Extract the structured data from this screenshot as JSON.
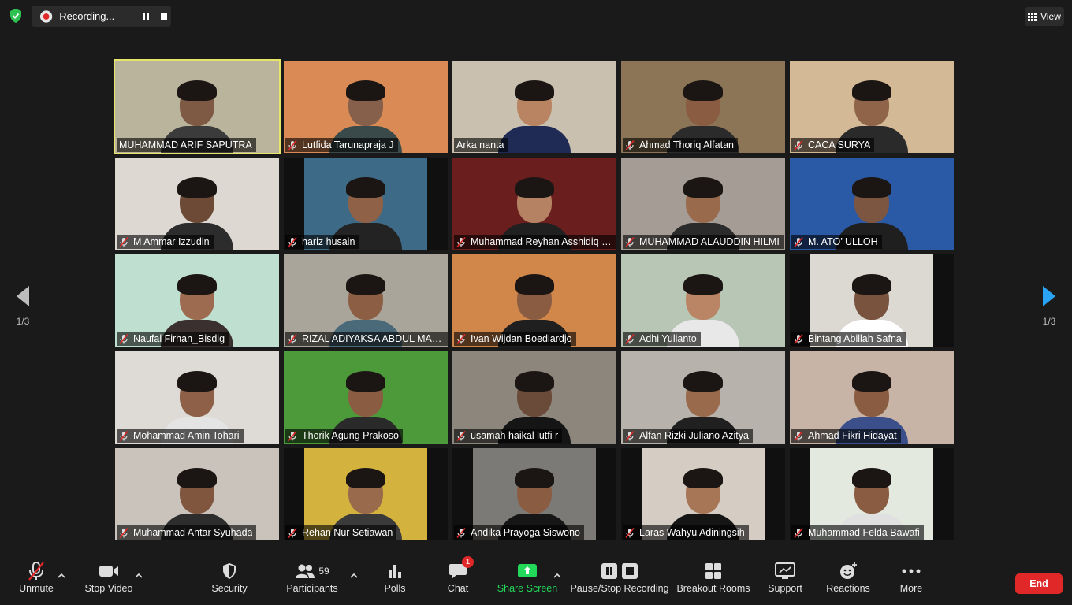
{
  "topbar": {
    "recording_label": "Recording...",
    "view_label": "View"
  },
  "nav": {
    "left_page": "1/3",
    "right_page": "1/3"
  },
  "participants": [
    {
      "name": "MUHAMMAD ARIF SAPUTRA",
      "muted": false,
      "active": true,
      "bg": "#b9b49b",
      "skin": "#7e5a45",
      "shirt": "#3b3b3b"
    },
    {
      "name": "Lutfida Tarunapraja J",
      "muted": true,
      "bg": "#d98a55",
      "skin": "#86604a",
      "shirt": "#3a4a4a"
    },
    {
      "name": "Arka nanta",
      "muted": false,
      "bg": "#c9c0b0",
      "skin": "#b88462",
      "shirt": "#1f2a55"
    },
    {
      "name": "Ahmad Thoriq Alfatan",
      "muted": true,
      "bg": "#8c7456",
      "skin": "#8a5d43",
      "shirt": "#2b2b2b"
    },
    {
      "name": "CACA SURYA",
      "muted": true,
      "bg": "#d4b996",
      "skin": "#8f6448",
      "shirt": "#2a2a2a"
    },
    {
      "name": "M Ammar Izzudin",
      "muted": true,
      "bg": "#ddd8d2",
      "skin": "#6d4a36",
      "shirt": "#2c2c2c"
    },
    {
      "name": "hariz husain",
      "muted": true,
      "bg": "#3d6a86",
      "skin": "#8f6247",
      "shirt": "#232323",
      "sides": true
    },
    {
      "name": "Muhammad Reyhan Asshidiq Rahmat",
      "muted": true,
      "bg": "#6a1e1e",
      "skin": "#b58364",
      "shirt": "#202020"
    },
    {
      "name": "MUHAMMAD ALAUDDIN HILMI",
      "muted": true,
      "bg": "#a49c95",
      "skin": "#9a6a4d",
      "shirt": "#2b2b2b"
    },
    {
      "name": "M. ATO’ ULLOH",
      "muted": true,
      "bg": "#2a5aa5",
      "skin": "#7d5641",
      "shirt": "#1f1f1f"
    },
    {
      "name": "Naufal Firhan_Bisdig",
      "muted": true,
      "bg": "#bfe0d0",
      "skin": "#9c6b50",
      "shirt": "#3a3030"
    },
    {
      "name": "RIZAL ADIYAKSA ABDUL MALIK",
      "muted": true,
      "bg": "#a9a59a",
      "skin": "#8c5f45",
      "shirt": "#4a6a7a"
    },
    {
      "name": "Ivan Wijdan Boediardjo",
      "muted": true,
      "bg": "#d2874a",
      "skin": "#8a5d43",
      "shirt": "#1f1f1f"
    },
    {
      "name": "Adhi Yulianto",
      "muted": true,
      "bg": "#b8c7b5",
      "skin": "#b98565",
      "shirt": "#e8e8e8"
    },
    {
      "name": "Bintang Abillah Safna",
      "muted": true,
      "bg": "#dcd9d3",
      "skin": "#7a533f",
      "shirt": "#ffffff",
      "sides": true
    },
    {
      "name": "Mohammad Amin Tohari",
      "muted": true,
      "bg": "#dedbd6",
      "skin": "#8d6047",
      "shirt": "#e4e4e4"
    },
    {
      "name": "Thorik Agung Prakoso",
      "muted": true,
      "bg": "#4d9a3a",
      "skin": "#8a5d43",
      "shirt": "#2a2a2a"
    },
    {
      "name": "usamah haikal lutfi r",
      "muted": true,
      "bg": "#8d867d",
      "skin": "#6a4a38",
      "shirt": "#151515"
    },
    {
      "name": "Alfan Rizki Juliano Azitya",
      "muted": true,
      "bg": "#b7b2ab",
      "skin": "#9a6a4d",
      "shirt": "#202020"
    },
    {
      "name": "Ahmad Fikri Hidayat",
      "muted": true,
      "bg": "#c8b4a6",
      "skin": "#8a5d43",
      "shirt": "#3b4f8a"
    },
    {
      "name": "Muhammad Antar Syuhada",
      "muted": true,
      "bg": "#c9c3bc",
      "skin": "#80563f",
      "shirt": "#2d2d2d"
    },
    {
      "name": "Rehan Nur Setiawan",
      "muted": true,
      "bg": "#d4b23e",
      "skin": "#9a6a4d",
      "shirt": "#3a3a3a",
      "sides": true
    },
    {
      "name": "Andika Prayoga Siswono",
      "muted": true,
      "bg": "#7c7a76",
      "skin": "#8a5d43",
      "shirt": "#161616",
      "sides": true
    },
    {
      "name": "Laras Wahyu Adiningsih",
      "muted": true,
      "bg": "#d5ccc4",
      "skin": "#a77657",
      "shirt": "#151515",
      "sides": true
    },
    {
      "name": "Muhammad Felda Bawafi",
      "muted": true,
      "bg": "#e3e9df",
      "skin": "#8a5d43",
      "shirt": "#e0e0e0",
      "sides": true
    }
  ],
  "toolbar": {
    "unmute": "Unmute",
    "stop_video": "Stop Video",
    "security": "Security",
    "participants": "Participants",
    "participant_count": "59",
    "polls": "Polls",
    "chat": "Chat",
    "chat_badge": "1",
    "share_screen": "Share Screen",
    "pause_recording": "Pause/Stop Recording",
    "breakout_rooms": "Breakout Rooms",
    "support": "Support",
    "reactions": "Reactions",
    "more": "More",
    "end": "End"
  },
  "colors": {
    "share_green": "#23d959",
    "active_speaker": "#e8e56b",
    "end_red": "#e02828",
    "nav_blue": "#2aa3f3"
  }
}
